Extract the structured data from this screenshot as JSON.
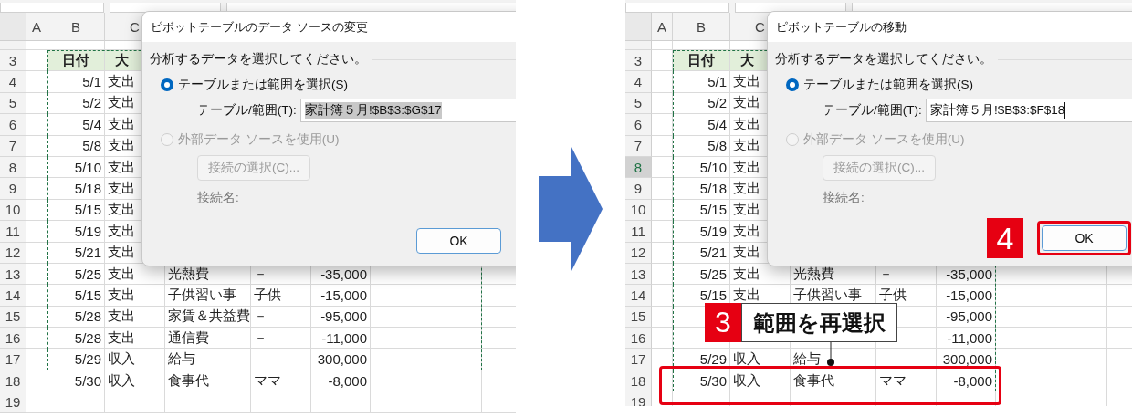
{
  "panels": [
    {
      "sheet": {
        "column_headers": [
          "A",
          "B",
          "C"
        ],
        "selection_covers_column_g": true,
        "rows": [
          {
            "number": "3",
            "kind": "header",
            "selected": false,
            "in_selection": true,
            "cells": [
              "日付",
              "大",
              null,
              null,
              null
            ]
          },
          {
            "number": "4",
            "kind": "data",
            "selected": false,
            "in_selection": true,
            "cells": [
              "5/1",
              "支出",
              null,
              null,
              null
            ]
          },
          {
            "number": "5",
            "kind": "data",
            "selected": false,
            "in_selection": true,
            "cells": [
              "5/2",
              "支出",
              null,
              null,
              null
            ]
          },
          {
            "number": "6",
            "kind": "data",
            "selected": false,
            "in_selection": true,
            "cells": [
              "5/4",
              "支出",
              null,
              null,
              null
            ]
          },
          {
            "number": "7",
            "kind": "data",
            "selected": false,
            "in_selection": true,
            "cells": [
              "5/8",
              "支出",
              null,
              null,
              null
            ]
          },
          {
            "number": "8",
            "kind": "data",
            "selected": false,
            "in_selection": true,
            "cells": [
              "5/10",
              "支出",
              null,
              null,
              null
            ]
          },
          {
            "number": "9",
            "kind": "data",
            "selected": false,
            "in_selection": true,
            "cells": [
              "5/18",
              "支出",
              null,
              null,
              null
            ]
          },
          {
            "number": "10",
            "kind": "data",
            "selected": false,
            "in_selection": true,
            "cells": [
              "5/15",
              "支出",
              null,
              null,
              null
            ]
          },
          {
            "number": "11",
            "kind": "data",
            "selected": false,
            "in_selection": true,
            "cells": [
              "5/19",
              "支出",
              null,
              null,
              null
            ]
          },
          {
            "number": "12",
            "kind": "data",
            "selected": false,
            "in_selection": true,
            "cells": [
              "5/21",
              "支出",
              null,
              null,
              null
            ]
          },
          {
            "number": "13",
            "kind": "data",
            "selected": false,
            "in_selection": true,
            "cells": [
              "5/25",
              "支出",
              "光熱費",
              "－",
              "-35,000"
            ]
          },
          {
            "number": "14",
            "kind": "data",
            "selected": false,
            "in_selection": true,
            "cells": [
              "5/15",
              "支出",
              "子供習い事",
              "子供",
              "-15,000"
            ]
          },
          {
            "number": "15",
            "kind": "data",
            "selected": false,
            "in_selection": true,
            "cells": [
              "5/28",
              "支出",
              "家賃＆共益費",
              "－",
              "-95,000"
            ]
          },
          {
            "number": "16",
            "kind": "data",
            "selected": false,
            "in_selection": true,
            "cells": [
              "5/28",
              "支出",
              "通信費",
              "－",
              "-11,000"
            ]
          },
          {
            "number": "17",
            "kind": "data",
            "selected": false,
            "in_selection": true,
            "cells": [
              "5/29",
              "収入",
              "給与",
              null,
              "300,000"
            ]
          },
          {
            "number": "18",
            "kind": "data",
            "selected": false,
            "in_selection": false,
            "cells": [
              "5/30",
              "収入",
              "食事代",
              "ママ",
              "-8,000"
            ]
          },
          {
            "number": "19",
            "kind": "data",
            "selected": false,
            "in_selection": false,
            "cells": [
              null,
              null,
              null,
              null,
              null
            ]
          }
        ]
      },
      "dialog": {
        "title": "ピボットテーブルのデータ ソースの変更",
        "prompt": "分析するデータを選択してください。",
        "options": [
          {
            "label": "テーブルまたは範囲を選択(S)",
            "selected": true,
            "disabled": false
          },
          {
            "label": "外部データ ソースを使用(U)",
            "selected": false,
            "disabled": true
          }
        ],
        "range_label": "テーブル/範囲(T):",
        "range_value": "家計簿５月!$B$3:$G$17",
        "value_selected": true,
        "connection_button": {
          "label": "接続の選択(C)...",
          "disabled": true
        },
        "connection_label": "接続名:",
        "ok": {
          "label": "OK",
          "highlighted": false
        }
      }
    },
    {
      "sheet": {
        "column_headers": [
          "A",
          "B",
          "C"
        ],
        "selection_covers_column_g": false,
        "rows": [
          {
            "number": "3",
            "kind": "header",
            "selected": false,
            "in_selection": true,
            "cells": [
              "日付",
              "大",
              null,
              null,
              null
            ]
          },
          {
            "number": "4",
            "kind": "data",
            "selected": false,
            "in_selection": true,
            "cells": [
              "5/1",
              "支出",
              null,
              null,
              null
            ]
          },
          {
            "number": "5",
            "kind": "data",
            "selected": false,
            "in_selection": true,
            "cells": [
              "5/2",
              "支出",
              null,
              null,
              null
            ]
          },
          {
            "number": "6",
            "kind": "data",
            "selected": false,
            "in_selection": true,
            "cells": [
              "5/4",
              "支出",
              null,
              null,
              null
            ]
          },
          {
            "number": "7",
            "kind": "data",
            "selected": false,
            "in_selection": true,
            "cells": [
              "5/8",
              "支出",
              null,
              null,
              null
            ]
          },
          {
            "number": "8",
            "kind": "data",
            "selected": true,
            "in_selection": true,
            "cells": [
              "5/10",
              "支出",
              null,
              null,
              null
            ]
          },
          {
            "number": "9",
            "kind": "data",
            "selected": false,
            "in_selection": true,
            "cells": [
              "5/18",
              "支出",
              null,
              null,
              null
            ]
          },
          {
            "number": "10",
            "kind": "data",
            "selected": false,
            "in_selection": true,
            "cells": [
              "5/15",
              "支出",
              null,
              null,
              null
            ]
          },
          {
            "number": "11",
            "kind": "data",
            "selected": false,
            "in_selection": true,
            "cells": [
              "5/19",
              "支出",
              null,
              null,
              null
            ]
          },
          {
            "number": "12",
            "kind": "data",
            "selected": false,
            "in_selection": true,
            "cells": [
              "5/21",
              "支出",
              null,
              null,
              null
            ]
          },
          {
            "number": "13",
            "kind": "data",
            "selected": false,
            "in_selection": true,
            "cells": [
              "5/25",
              "支出",
              "光熱費",
              "－",
              "-35,000"
            ]
          },
          {
            "number": "14",
            "kind": "data",
            "selected": false,
            "in_selection": true,
            "cells": [
              "5/15",
              "支出",
              "子供習い事",
              "子供",
              "-15,000"
            ]
          },
          {
            "number": "15",
            "kind": "data",
            "selected": false,
            "in_selection": true,
            "cells": [
              null,
              null,
              null,
              null,
              "-95,000"
            ]
          },
          {
            "number": "16",
            "kind": "data",
            "selected": false,
            "in_selection": true,
            "cells": [
              null,
              null,
              null,
              null,
              "-11,000"
            ]
          },
          {
            "number": "17",
            "kind": "data",
            "selected": false,
            "in_selection": true,
            "cells": [
              "5/29",
              "収入",
              "給与",
              null,
              "300,000"
            ]
          },
          {
            "number": "18",
            "kind": "data",
            "selected": false,
            "in_selection": true,
            "cells": [
              "5/30",
              "収入",
              "食事代",
              "ママ",
              "-8,000"
            ]
          },
          {
            "number": "19",
            "kind": "data",
            "selected": false,
            "in_selection": false,
            "cells": [
              null,
              null,
              null,
              null,
              null
            ]
          }
        ]
      },
      "callout": {
        "number": "3",
        "text": "範囲を再選択"
      },
      "dialog": {
        "title": "ピボットテーブルの移動",
        "prompt": "分析するデータを選択してください。",
        "options": [
          {
            "label": "テーブルまたは範囲を選択(S)",
            "selected": true,
            "disabled": false
          },
          {
            "label": "外部データ ソースを使用(U)",
            "selected": false,
            "disabled": true
          }
        ],
        "range_label": "テーブル/範囲(T):",
        "range_value": "家計簿５月!$B$3:$F$18",
        "value_selected": false,
        "connection_button": {
          "label": "接続の選択(C)...",
          "disabled": true
        },
        "connection_label": "接続名:",
        "ok": {
          "label": "OK",
          "highlighted": true,
          "badge": "4"
        }
      }
    }
  ]
}
